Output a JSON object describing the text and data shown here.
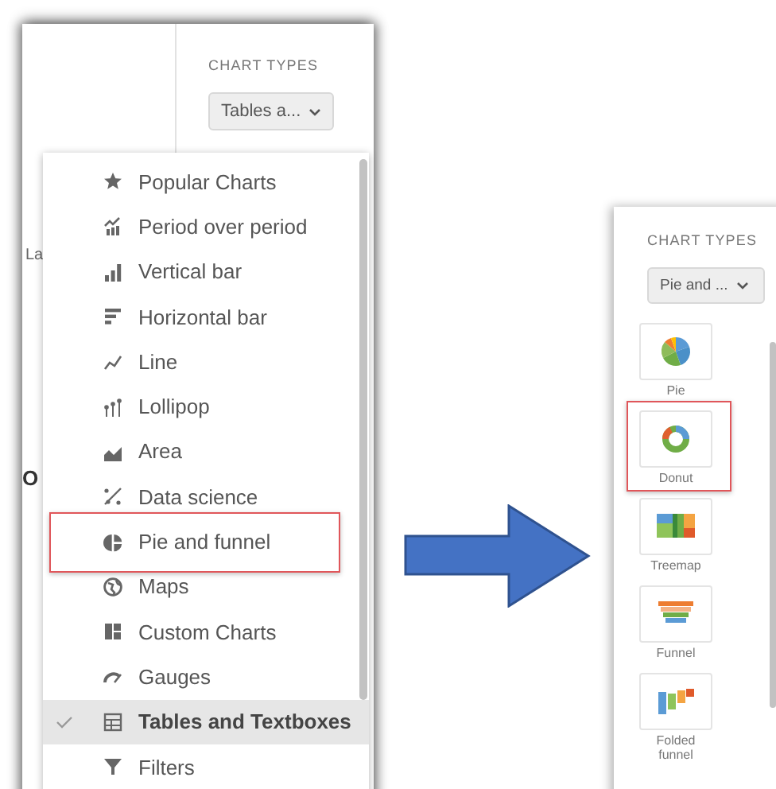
{
  "left_panel": {
    "section_title": "CHART TYPES",
    "dropdown": {
      "value": "Tables a..."
    },
    "fragments": [
      "La",
      "O"
    ],
    "menu": {
      "items": [
        {
          "label": "Popular Charts",
          "kind": "star",
          "selected": false,
          "marked": false
        },
        {
          "label": "Period over period",
          "kind": "period",
          "selected": false,
          "marked": false
        },
        {
          "label": "Vertical bar",
          "kind": "vbar",
          "selected": false,
          "marked": false
        },
        {
          "label": "Horizontal bar",
          "kind": "hbar",
          "selected": false,
          "marked": false
        },
        {
          "label": "Line",
          "kind": "line",
          "selected": false,
          "marked": false
        },
        {
          "label": "Lollipop",
          "kind": "lollipop",
          "selected": false,
          "marked": false
        },
        {
          "label": "Area",
          "kind": "area",
          "selected": false,
          "marked": false
        },
        {
          "label": "Data science",
          "kind": "science",
          "selected": false,
          "marked": false
        },
        {
          "label": "Pie and funnel",
          "kind": "pie",
          "selected": false,
          "marked": true
        },
        {
          "label": "Maps",
          "kind": "globe",
          "selected": false,
          "marked": false
        },
        {
          "label": "Custom Charts",
          "kind": "custom",
          "selected": false,
          "marked": false
        },
        {
          "label": "Gauges",
          "kind": "gauge",
          "selected": false,
          "marked": false
        },
        {
          "label": "Tables and Textboxes",
          "kind": "table",
          "selected": true,
          "marked": false
        },
        {
          "label": "Filters",
          "kind": "filter",
          "selected": false,
          "marked": false
        }
      ]
    }
  },
  "right_panel": {
    "section_title": "CHART TYPES",
    "dropdown": {
      "value": "Pie and ..."
    },
    "tiles": [
      {
        "label": "Pie",
        "kind": "pie",
        "marked": false
      },
      {
        "label": "Donut",
        "kind": "donut",
        "marked": true
      },
      {
        "label": "Treemap",
        "kind": "treemap",
        "marked": false
      },
      {
        "label": "Funnel",
        "kind": "funnel",
        "marked": false
      },
      {
        "label": "Folded funnel",
        "kind": "folded",
        "marked": false
      }
    ]
  }
}
